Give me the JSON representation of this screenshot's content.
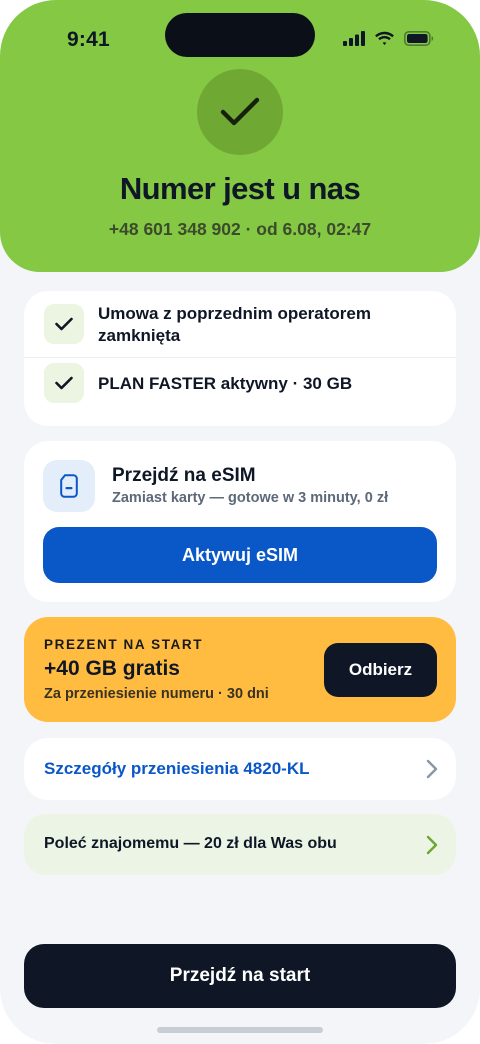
{
  "status_bar": {
    "time": "9:41"
  },
  "hero": {
    "title": "Numer jest u nas",
    "subtitle": "+48 601 348 902 · od 6.08, 02:47"
  },
  "status_items": [
    {
      "label": "Umowa z poprzednim operatorem zamknięta"
    },
    {
      "label": "PLAN FASTER aktywny · 30 GB"
    }
  ],
  "esim": {
    "title": "Przejdź na eSIM",
    "subtitle": "Zamiast karty — gotowe w 3 minuty, 0 zł",
    "button_label": "Aktywuj eSIM"
  },
  "gift": {
    "eyebrow": "PREZENT NA START",
    "title": "+40 GB gratis",
    "subtitle": "Za przeniesienie numeru · 30 dni",
    "button_label": "Odbierz"
  },
  "details_link": {
    "label": "Szczegóły przeniesienia 4820-KL"
  },
  "referral": {
    "label": "Poleć znajomemu — 20 zł dla Was obu"
  },
  "primary_action": {
    "label": "Przejdź na start"
  },
  "colors": {
    "hero_green": "#84c843",
    "primary_blue": "#0a57c7",
    "gift_yellow": "#ffbc40",
    "dark": "#0f1726"
  }
}
